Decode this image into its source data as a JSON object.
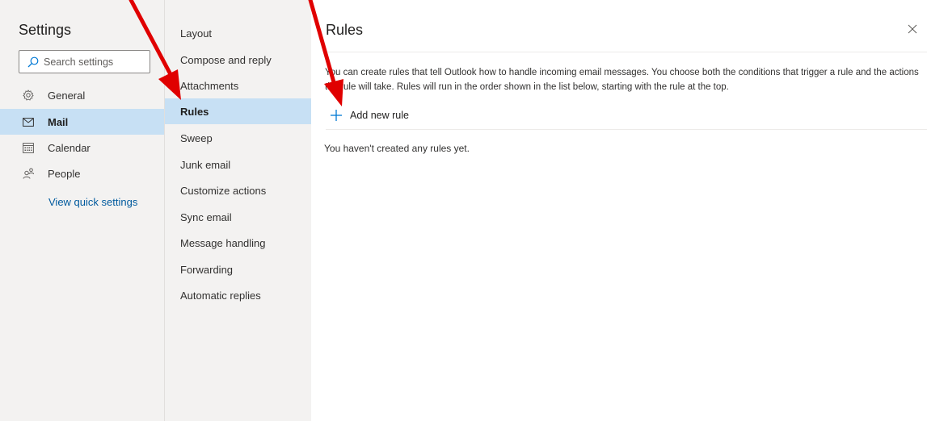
{
  "settings": {
    "title": "Settings",
    "search_placeholder": "Search settings",
    "nav": [
      {
        "label": "General",
        "icon": "gear-icon"
      },
      {
        "label": "Mail",
        "icon": "mail-icon",
        "selected": true
      },
      {
        "label": "Calendar",
        "icon": "calendar-icon"
      },
      {
        "label": "People",
        "icon": "people-icon"
      }
    ],
    "quick_settings_link": "View quick settings"
  },
  "categories": [
    {
      "label": "Layout"
    },
    {
      "label": "Compose and reply"
    },
    {
      "label": "Attachments"
    },
    {
      "label": "Rules",
      "selected": true
    },
    {
      "label": "Sweep"
    },
    {
      "label": "Junk email"
    },
    {
      "label": "Customize actions"
    },
    {
      "label": "Sync email"
    },
    {
      "label": "Message handling"
    },
    {
      "label": "Forwarding"
    },
    {
      "label": "Automatic replies"
    }
  ],
  "content": {
    "title": "Rules",
    "close_icon": "close-icon",
    "description": "You can create rules that tell Outlook how to handle incoming email messages. You choose both the conditions that trigger a rule and the actions the rule will take. Rules will run in the order shown in the list below, starting with the rule at the top.",
    "add_rule_label": "Add new rule",
    "empty_message": "You haven't created any rules yet."
  },
  "colors": {
    "selected_bg": "#c7e0f4",
    "link": "#005a9e",
    "pane_bg": "#f3f2f1",
    "annotation_arrow": "#e00000"
  }
}
